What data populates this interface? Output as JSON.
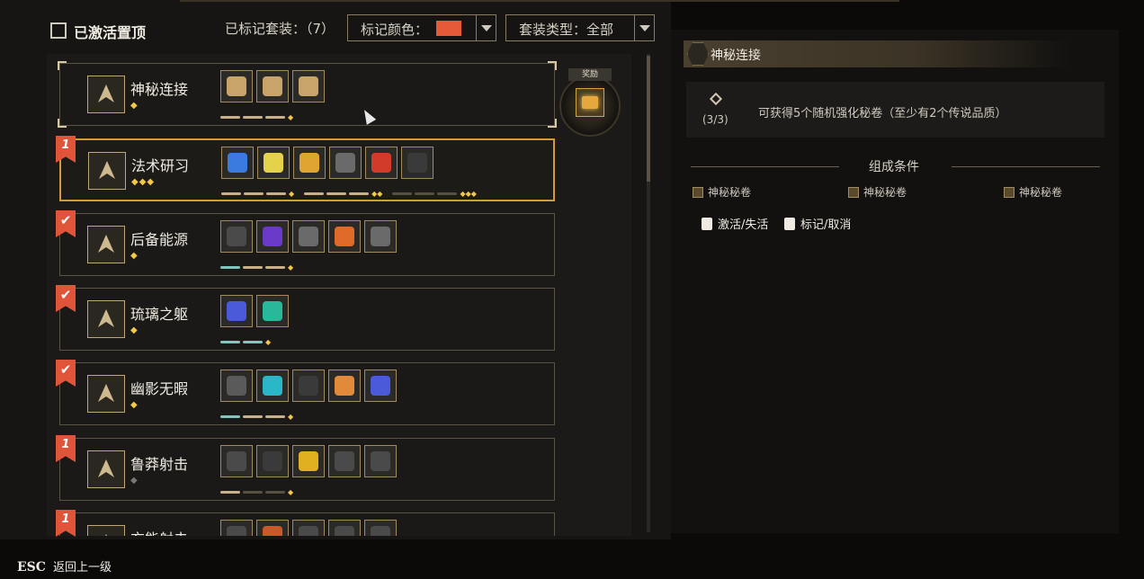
{
  "toolbar": {
    "pin_active_label": "已激活置顶",
    "marked_sets_label": "已标记套装：（7）",
    "mark_color_label": "标记颜色：",
    "mark_color": "#e65a38",
    "set_type_label": "套装类型：全部"
  },
  "reward": {
    "label": "奖励"
  },
  "sets": [
    {
      "name": "神秘连接",
      "flag": "",
      "diamonds": "◆",
      "items": [
        "#c9a46a",
        "#c9a46a",
        "#c9a46a"
      ],
      "bars": [
        "gold",
        "gold",
        "gold"
      ]
    },
    {
      "name": "法术研习",
      "flag": "1",
      "diamonds": "◆◆◆",
      "items": [
        "#3a7be0",
        "#e3d24a",
        "#e0a530",
        "#6a6a6a",
        "#d23a2a",
        "#3a3a3a"
      ],
      "bars": [
        "gold",
        "gold",
        "gold"
      ]
    },
    {
      "name": "后备能源",
      "flag": "✔",
      "diamonds": "◆",
      "items": [
        "#4a4a4a",
        "#6a3ac8",
        "#6a6a6a",
        "#e06a2a",
        "#6a6a6a"
      ],
      "bars": [
        "teal",
        "gold",
        "gold"
      ]
    },
    {
      "name": "琉璃之躯",
      "flag": "✔",
      "diamonds": "◆",
      "items": [
        "#4a5ad8",
        "#2ab89a"
      ],
      "bars": [
        "teal",
        "teal"
      ]
    },
    {
      "name": "幽影无暇",
      "flag": "✔",
      "diamonds": "◆",
      "items": [
        "#5a5a5a",
        "#2ab8c8",
        "#3a3a3a",
        "#e08a3a",
        "#4a5ad8"
      ],
      "bars": [
        "teal",
        "gold",
        "gold"
      ]
    },
    {
      "name": "鲁莽射击",
      "flag": "1",
      "diamonds": "◆",
      "items": [
        "#4a4a4a",
        "#3a3a3a",
        "#e0b020",
        "#4a4a4a",
        "#4a4a4a"
      ],
      "bars": [
        "gold",
        "dim",
        "dim"
      ]
    },
    {
      "name": "充能射击",
      "flag": "1",
      "diamonds": "◆",
      "items": [
        "#4a4a4a",
        "#c85a2a",
        "#4a4a4a",
        "#4a4a4a",
        "#4a4a4a"
      ],
      "bars": [
        "gold",
        "gold",
        "gold"
      ]
    }
  ],
  "detail": {
    "title": "神秘连接",
    "bonus_count": "(3/3)",
    "bonus_desc": "可获得5个随机强化秘卷（至少有2个传说品质）",
    "conditions_title": "组成条件",
    "requirements": [
      "神秘秘卷",
      "神秘秘卷",
      "神秘秘卷"
    ],
    "action_toggle": "激活/失活",
    "action_mark": "标记/取消"
  },
  "footer": {
    "esc_key": "ESC",
    "esc_label": "返回上一级"
  }
}
